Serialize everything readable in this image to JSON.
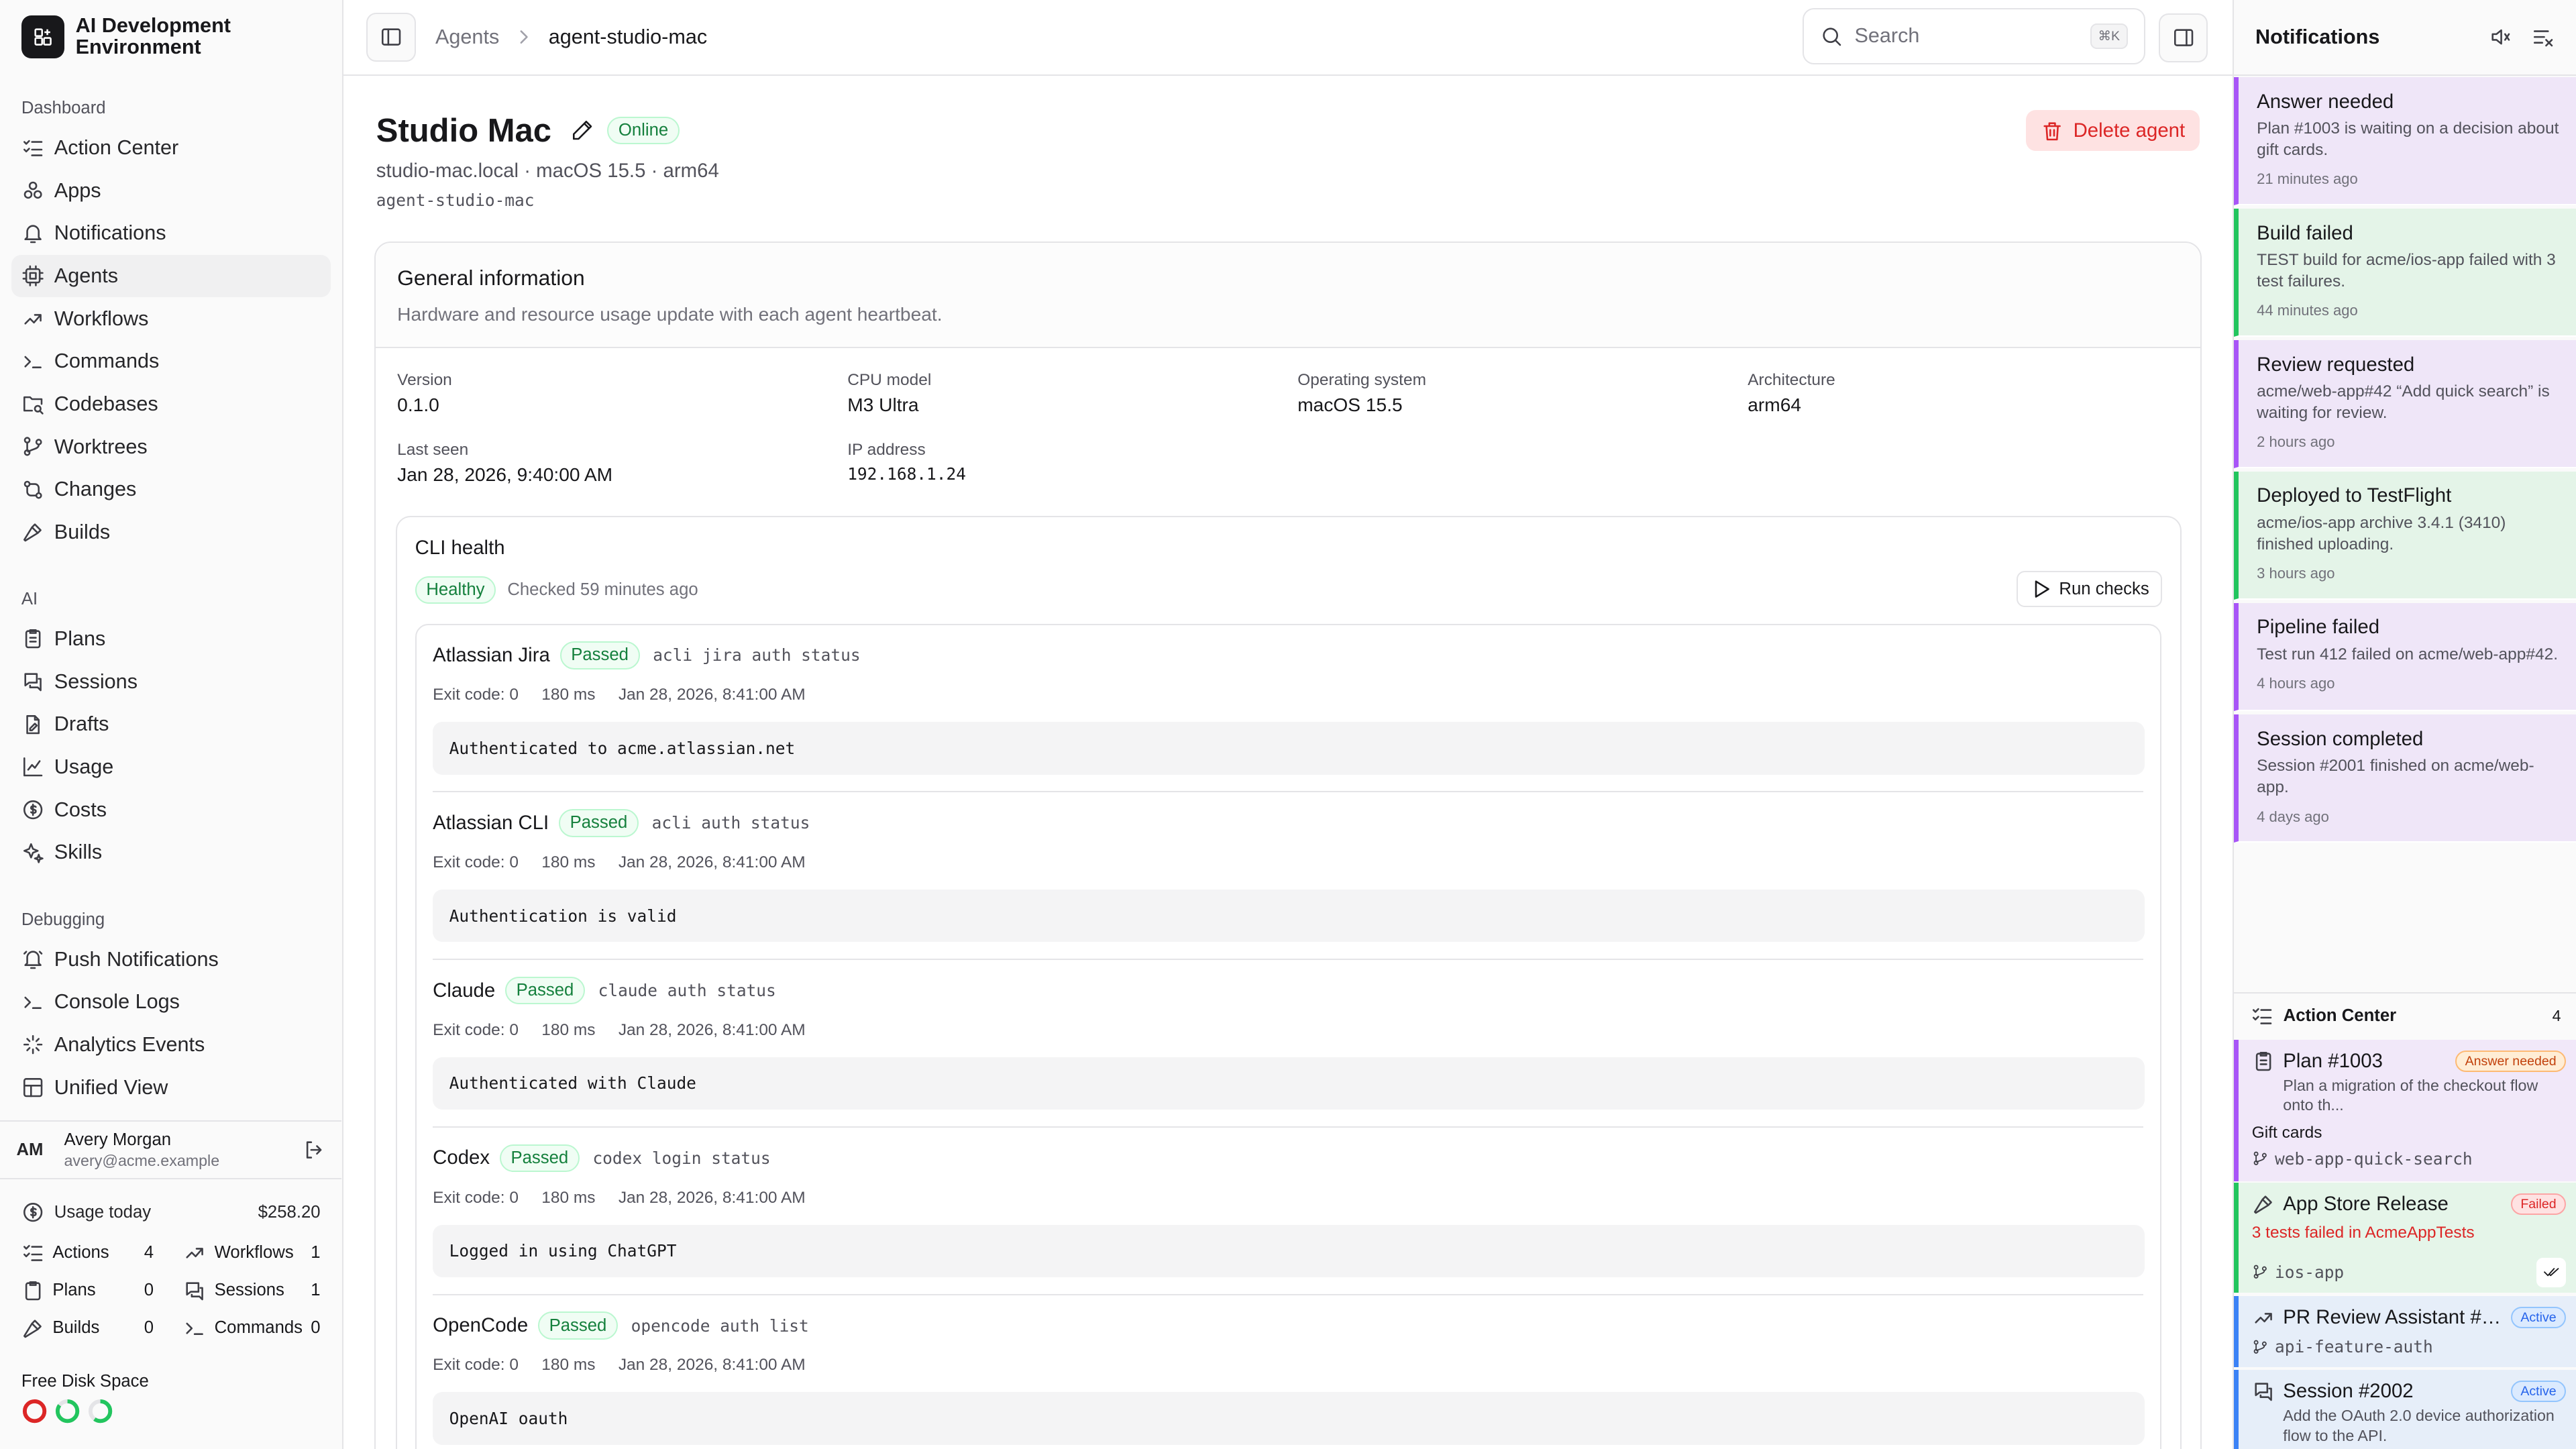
{
  "sidebar": {
    "brand": "AI Development Environment",
    "groups": [
      {
        "label": "Dashboard",
        "items": [
          "Action Center",
          "Apps",
          "Notifications",
          "Agents",
          "Workflows",
          "Commands",
          "Codebases",
          "Worktrees",
          "Changes",
          "Builds"
        ]
      },
      {
        "label": "AI",
        "items": [
          "Plans",
          "Sessions",
          "Drafts",
          "Usage",
          "Costs",
          "Skills"
        ]
      },
      {
        "label": "Debugging",
        "items": [
          "Push Notifications",
          "Console Logs",
          "Analytics Events",
          "Unified View"
        ]
      }
    ],
    "active_item": "Agents",
    "user": {
      "initials": "AM",
      "name": "Avery Morgan",
      "email": "avery@acme.example"
    },
    "usage": {
      "label": "Usage today",
      "amount": "$258.20",
      "stats": [
        {
          "label": "Actions",
          "value": "4"
        },
        {
          "label": "Workflows",
          "value": "1"
        },
        {
          "label": "Plans",
          "value": "0"
        },
        {
          "label": "Sessions",
          "value": "1"
        },
        {
          "label": "Builds",
          "value": "0"
        },
        {
          "label": "Commands",
          "value": "0"
        }
      ]
    },
    "disk": {
      "label": "Free Disk Space",
      "rings": [
        {
          "color": "#dc2626",
          "fill": 0.05
        },
        {
          "color": "#22c55e",
          "fill": 0.85
        },
        {
          "color": "#22c55e",
          "fill": 0.6
        }
      ]
    }
  },
  "header": {
    "breadcrumb_parent": "Agents",
    "breadcrumb_current": "agent-studio-mac",
    "search_placeholder": "Search",
    "search_shortcut": "⌘K"
  },
  "agent": {
    "name": "Studio Mac",
    "status": "Online",
    "subtitle": "studio-mac.local · macOS 15.5 · arm64",
    "id": "agent-studio-mac",
    "delete_label": "Delete agent"
  },
  "general": {
    "title": "General information",
    "subtitle": "Hardware and resource usage update with each agent heartbeat.",
    "fields": [
      {
        "key": "Version",
        "value": "0.1.0",
        "mono": false
      },
      {
        "key": "CPU model",
        "value": "M3 Ultra",
        "mono": false
      },
      {
        "key": "Operating system",
        "value": "macOS 15.5",
        "mono": false
      },
      {
        "key": "Architecture",
        "value": "arm64",
        "mono": false
      },
      {
        "key": "Last seen",
        "value": "Jan 28, 2026, 9:40:00 AM",
        "mono": false
      },
      {
        "key": "IP address",
        "value": "192.168.1.24",
        "mono": true
      }
    ]
  },
  "cli_health": {
    "title": "CLI health",
    "status": "Healthy",
    "checked": "Checked 59 minutes ago",
    "run_label": "Run checks",
    "checks": [
      {
        "name": "Atlassian Jira",
        "status": "Passed",
        "command": "acli jira auth status",
        "exit": "Exit code: 0",
        "duration": "180 ms",
        "time": "Jan 28, 2026, 8:41:00 AM",
        "output": "Authenticated to acme.atlassian.net"
      },
      {
        "name": "Atlassian CLI",
        "status": "Passed",
        "command": "acli auth status",
        "exit": "Exit code: 0",
        "duration": "180 ms",
        "time": "Jan 28, 2026, 8:41:00 AM",
        "output": "Authentication is valid"
      },
      {
        "name": "Claude",
        "status": "Passed",
        "command": "claude auth status",
        "exit": "Exit code: 0",
        "duration": "180 ms",
        "time": "Jan 28, 2026, 8:41:00 AM",
        "output": "Authenticated with Claude"
      },
      {
        "name": "Codex",
        "status": "Passed",
        "command": "codex login status",
        "exit": "Exit code: 0",
        "duration": "180 ms",
        "time": "Jan 28, 2026, 8:41:00 AM",
        "output": "Logged in using ChatGPT"
      },
      {
        "name": "OpenCode",
        "status": "Passed",
        "command": "opencode auth list",
        "exit": "Exit code: 0",
        "duration": "180 ms",
        "time": "Jan 28, 2026, 8:41:00 AM",
        "output": "OpenAI oauth"
      }
    ]
  },
  "notifications": {
    "title": "Notifications",
    "items": [
      {
        "title": "Answer needed",
        "body": "Plan #1003 is waiting on a decision about gift cards.",
        "time": "21 minutes ago",
        "tone": "purple"
      },
      {
        "title": "Build failed",
        "body": "TEST build for acme/ios-app failed with 3 test failures.",
        "time": "44 minutes ago",
        "tone": "green"
      },
      {
        "title": "Review requested",
        "body": "acme/web-app#42 “Add quick search” is waiting for review.",
        "time": "2 hours ago",
        "tone": "purple"
      },
      {
        "title": "Deployed to TestFlight",
        "body": "acme/ios-app archive 3.4.1 (3410) finished uploading.",
        "time": "3 hours ago",
        "tone": "green"
      },
      {
        "title": "Pipeline failed",
        "body": "Test run 412 failed on acme/web-app#42.",
        "time": "4 hours ago",
        "tone": "purple"
      },
      {
        "title": "Session completed",
        "body": "Session #2001 finished on acme/web-app.",
        "time": "4 days ago",
        "tone": "purple"
      }
    ]
  },
  "action_center": {
    "title": "Action Center",
    "count": "4",
    "items": [
      {
        "name": "Plan #1003",
        "badge": "Answer needed",
        "desc": "Plan a migration of the checkout flow onto th...",
        "extra": "Gift cards",
        "branch": "web-app-quick-search"
      },
      {
        "name": "App Store Release",
        "badge": "Failed",
        "desc": "3 tests failed in AcmeAppTests",
        "branch": "ios-app"
      },
      {
        "name": "PR Review Assistant #4...",
        "badge": "Active",
        "branch": "api-feature-auth"
      },
      {
        "name": "Session #2002",
        "badge": "Active",
        "desc": "Add the OAuth 2.0 device authorization flow to the API."
      }
    ]
  }
}
